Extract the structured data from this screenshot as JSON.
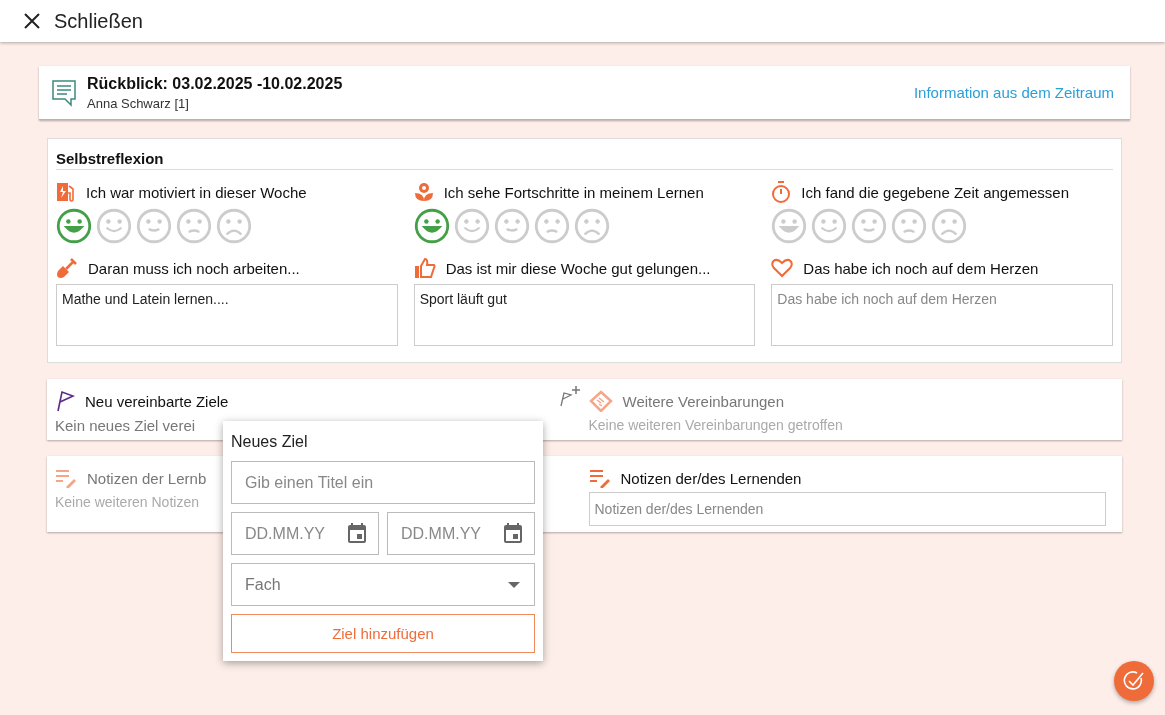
{
  "close": {
    "label": "Schließen"
  },
  "header": {
    "title": "Rückblick: 03.02.2025 -10.02.2025",
    "subtitle": "Anna Schwarz [1]",
    "link": "Information aus dem Zeitraum"
  },
  "reflection": {
    "title": "Selbstreflexion",
    "ratings": [
      {
        "kind": "motivation",
        "label": "Ich war motiviert in dieser Woche",
        "faces": [
          {
            "selected": true
          },
          {
            "selected": false
          },
          {
            "selected": false
          },
          {
            "selected": false
          },
          {
            "selected": false
          }
        ]
      },
      {
        "kind": "progress",
        "label": "Ich sehe Fortschritte in meinem Lernen",
        "faces": [
          {
            "selected": true
          },
          {
            "selected": false
          },
          {
            "selected": false
          },
          {
            "selected": false
          },
          {
            "selected": false
          }
        ]
      },
      {
        "kind": "time",
        "label": "Ich fand die gegebene Zeit angemessen",
        "faces": [
          {
            "selected": false
          },
          {
            "selected": false
          },
          {
            "selected": false
          },
          {
            "selected": false
          },
          {
            "selected": false
          }
        ]
      }
    ],
    "notes": [
      {
        "kind": "work",
        "label": "Daran muss ich noch arbeiten...",
        "value": "Mathe und Latein lernen...."
      },
      {
        "kind": "success",
        "label": "Das ist mir diese Woche gut gelungen...",
        "value": "Sport läuft gut"
      },
      {
        "kind": "heart",
        "label": "Das habe ich noch auf dem Herzen",
        "placeholder": "Das habe ich noch auf dem Herzen"
      }
    ]
  },
  "goals": {
    "title": "Neu vereinbarte Ziele",
    "empty_text": "Kein neues Ziel verei",
    "disabled": false
  },
  "agreements": {
    "title": "Weitere Vereinbarungen",
    "empty_text": "Keine weiteren Vereinbarungen getroffen",
    "disabled": true
  },
  "coach_notes": {
    "title": "Notizen der Lernb",
    "empty_text": "Keine weiteren Notizen",
    "disabled": true
  },
  "learner_notes": {
    "title": "Notizen der/des Lernenden",
    "placeholder": "Notizen der/des Lernenden",
    "disabled": false
  },
  "new_goal_popup": {
    "title": "Neues Ziel",
    "title_placeholder": "Gib einen Titel ein",
    "start_placeholder": "DD.MM.YY",
    "end_placeholder": "DD.MM.YY",
    "subject_placeholder": "Fach",
    "button": "Ziel hinzufügen"
  }
}
